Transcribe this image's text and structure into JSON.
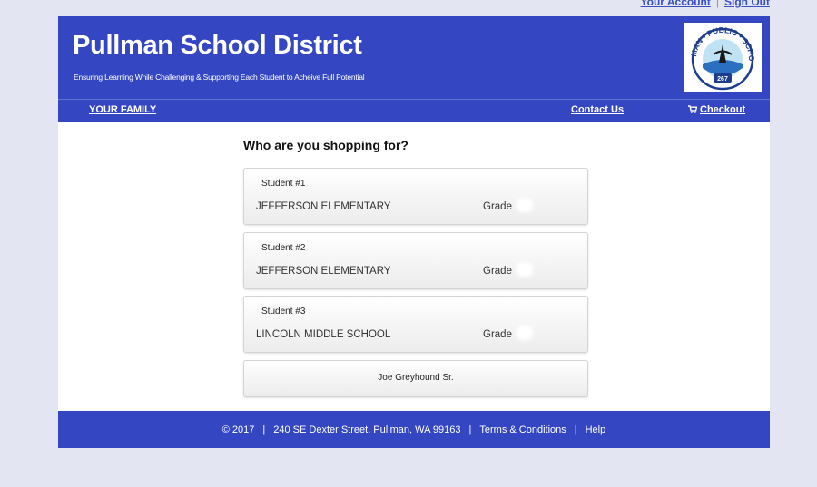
{
  "top_links": {
    "account": "Your Account",
    "separator": "|",
    "signout": "Sign Out"
  },
  "header": {
    "title": "Pullman School District",
    "tagline": "Ensuring Learning While Challenging & Supporting Each Student to Acheive Full Potential",
    "logo": {
      "top_text": "PULLMAN • PUBLIC • SCHOOLS",
      "number": "267",
      "icon": "pullman-public-schools-seal-icon"
    }
  },
  "nav": {
    "family": "YOUR FAMILY",
    "contact": "Contact Us",
    "checkout_icon": "cart-icon",
    "checkout": "Checkout"
  },
  "main": {
    "prompt": "Who are you shopping for?",
    "students": [
      {
        "label": "Student #1",
        "school": "JEFFERSON ELEMENTARY",
        "grade_label": "Grade"
      },
      {
        "label": "Student #2",
        "school": "JEFFERSON ELEMENTARY",
        "grade_label": "Grade"
      },
      {
        "label": "Student #3",
        "school": "LINCOLN MIDDLE SCHOOL",
        "grade_label": "Grade"
      }
    ],
    "parent": {
      "name": "Joe Greyhound Sr."
    }
  },
  "footer": {
    "copyright": "© 2017",
    "sep": "|",
    "address": "240 SE Dexter Street, Pullman, WA 99163",
    "terms": "Terms & Conditions",
    "help": "Help"
  },
  "colors": {
    "brand_blue": "#3446c2",
    "page_bg": "#e3e6f2"
  }
}
